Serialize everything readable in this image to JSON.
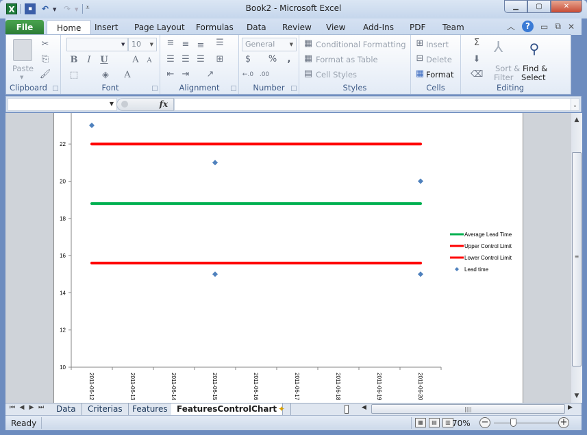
{
  "window": {
    "title": "Book2  -  Microsoft Excel",
    "minimize_icon": "minimize-icon",
    "maximize_icon": "restore-icon",
    "close_icon": "close-icon"
  },
  "quick_access": {
    "app_icon": "X",
    "save_icon": "save-icon",
    "undo_icon": "undo-icon",
    "redo_icon": "redo-icon",
    "customize_icon": "customize-qat-icon"
  },
  "ribbon_tabs": [
    "File",
    "Home",
    "Insert",
    "Page Layout",
    "Formulas",
    "Data",
    "Review",
    "View",
    "Add-Ins",
    "PDF",
    "Team"
  ],
  "ribbon_right": {
    "minimize_ribbon": "^",
    "help": "?"
  },
  "ribbon": {
    "clipboard": {
      "label": "Clipboard",
      "paste": "Paste"
    },
    "font": {
      "label": "Font",
      "font_name": "",
      "font_size": "10",
      "bold": "B",
      "italic": "I",
      "underline": "U",
      "grow": "A",
      "shrink": "A",
      "font_color": "A"
    },
    "alignment": {
      "label": "Alignment"
    },
    "number": {
      "label": "Number",
      "format": "General",
      "percent": "%",
      "comma": ","
    },
    "styles": {
      "label": "Styles",
      "conditional_formatting": "Conditional Formatting",
      "format_as_table": "Format as Table",
      "cell_styles": "Cell Styles"
    },
    "cells": {
      "label": "Cells",
      "insert": "Insert",
      "delete": "Delete",
      "format": "Format"
    },
    "editing": {
      "label": "Editing",
      "autosum": "Σ",
      "sort_filter_1": "Sort &",
      "sort_filter_2": "Filter",
      "find_select_1": "Find &",
      "find_select_2": "Select"
    }
  },
  "formula_bar": {
    "name_box": "",
    "fx": "fx",
    "formula": ""
  },
  "sheet_tabs": [
    {
      "label": "Data",
      "active": false
    },
    {
      "label": "Criterias",
      "active": false
    },
    {
      "label": "Features",
      "active": false
    },
    {
      "label": "FeaturesControlChart",
      "active": true
    }
  ],
  "status": {
    "text": "Ready",
    "zoom": "70%",
    "zoom_fraction": 0.7
  },
  "chart_data": {
    "type": "scatter",
    "title": "",
    "xlabel": "",
    "ylabel": "",
    "categories": [
      "2011-06-12",
      "2011-06-13",
      "2011-06-14",
      "2011-06-15",
      "2011-06-16",
      "2011-06-17",
      "2011-06-18",
      "2011-06-19",
      "2011-06-20"
    ],
    "yticks": [
      10,
      12,
      14,
      16,
      18,
      20,
      22
    ],
    "ylim": [
      10,
      24
    ],
    "grid": false,
    "legend_position": "right",
    "series": [
      {
        "name": "Average Lead Time",
        "kind": "line",
        "color": "#00b050",
        "x_from": "2011-06-12",
        "x_to": "2011-06-20",
        "value": 18.8
      },
      {
        "name": "Upper Control Limit",
        "kind": "line",
        "color": "#ff0000",
        "x_from": "2011-06-12",
        "x_to": "2011-06-20",
        "value": 22.0
      },
      {
        "name": "Lower Control Limit",
        "kind": "line",
        "color": "#ff0000",
        "x_from": "2011-06-12",
        "x_to": "2011-06-20",
        "value": 15.6
      },
      {
        "name": "Lead time",
        "kind": "points",
        "color": "#4f81bd",
        "points": [
          {
            "x": "2011-06-12",
            "y": 23
          },
          {
            "x": "2011-06-15",
            "y": 21
          },
          {
            "x": "2011-06-15",
            "y": 15
          },
          {
            "x": "2011-06-20",
            "y": 20
          },
          {
            "x": "2011-06-20",
            "y": 15
          }
        ]
      }
    ]
  }
}
